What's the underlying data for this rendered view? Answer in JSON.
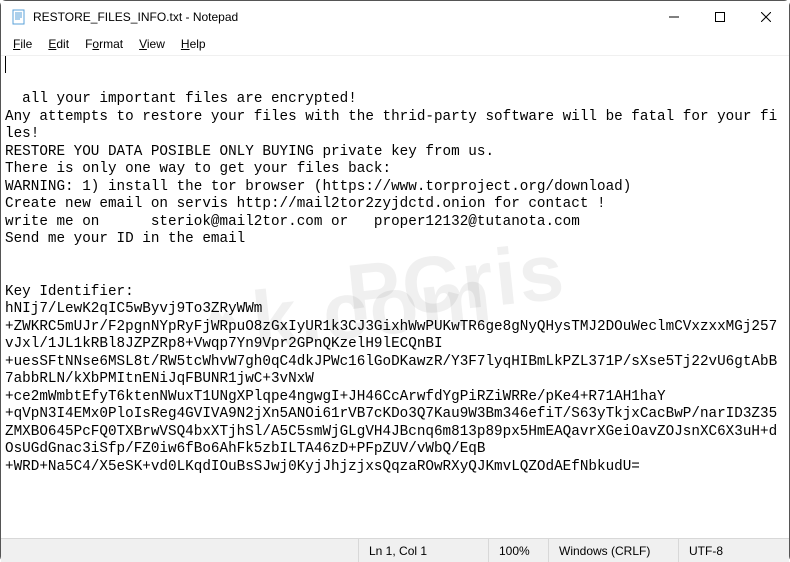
{
  "window": {
    "title": "RESTORE_FILES_INFO.txt - Notepad"
  },
  "menu": {
    "file": "File",
    "edit": "Edit",
    "format": "Format",
    "view": "View",
    "help": "Help"
  },
  "content": "all your important files are encrypted!\nAny attempts to restore your files with the thrid-party software will be fatal for your files!\nRESTORE YOU DATA POSIBLE ONLY BUYING private key from us.\nThere is only one way to get your files back:\nWARNING: 1) install the tor browser (https://www.torproject.org/download)\nCreate new email on servis http://mail2tor2zyjdctd.onion for contact !\nwrite me on      steriok@mail2tor.com or   proper12132@tutanota.com\nSend me your ID in the email\n\n\nKey Identifier:\nhNIj7/LewK2qIC5wByvj9To3ZRyWWm\n+ZWKRC5mUJr/F2pgnNYpRyFjWRpuO8zGxIyUR1k3CJ3GixhWwPUKwTR6ge8gNyQHysTMJ2DOuWeclmCVxzxxMGj257vJxl/1JL1kRBl8JZPZRp8+Vwqp7Yn9Vpr2GPnQKzelH9lECQnBI\n+uesSFtNNse6MSL8t/RW5tcWhvW7gh0qC4dkJPWc16lGoDKawzR/Y3F7lyqHIBmLkPZL371P/sXse5Tj22vU6gtAbB7abbRLN/kXbPMItnENiJqFBUNR1jwC+3vNxW\n+ce2mWmbtEfyT6ktenNWuxT1UNgXPlqpe4ngwgI+JH46CcArwfdYgPiRZiWRRe/pKe4+R71AH1haY\n+qVpN3I4EMx0PloIsReg4GVIVA9N2jXn5ANOi61rVB7cKDo3Q7Kau9W3Bm346efiT/S63yTkjxCacBwP/narID3Z35ZMXBO645PcFQ0TXBrwVSQ4bxXTjhSl/A5C5smWjGLgVH4JBcnq6m813p89px5HmEAQavrXGeiOavZOJsnXC6X3uH+dOsUGdGnac3iSfp/FZ0iw6fBo6AhFk5zbILTA46zD+PFpZUV/vWbQ/EqB\n+WRD+Na5C4/X5eSK+vd0LKqdIOuBsSJwj0KyjJhjzjxsQqzaROwRXyQJKmvLQZOdAEfNbkudU=",
  "status": {
    "position": "Ln 1, Col 1",
    "zoom": "100%",
    "lineend": "Windows (CRLF)",
    "encoding": "UTF-8"
  }
}
